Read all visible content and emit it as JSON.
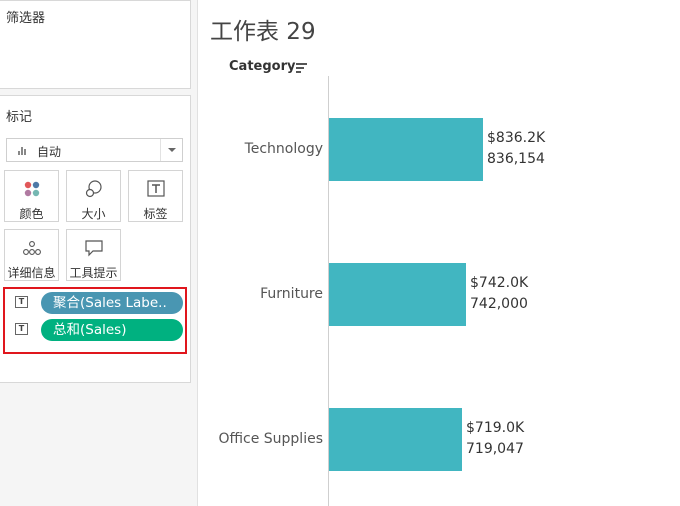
{
  "filters": {
    "title": "筛选器"
  },
  "marks": {
    "title": "标记",
    "mark_type": "自动",
    "buttons": [
      {
        "id": "color",
        "label": "颜色",
        "icon": "color-dots-icon"
      },
      {
        "id": "size",
        "label": "大小",
        "icon": "size-circles-icon"
      },
      {
        "id": "label",
        "label": "标签",
        "icon": "text-label-icon"
      },
      {
        "id": "detail",
        "label": "详细信息",
        "icon": "detail-dots-icon"
      },
      {
        "id": "tooltip",
        "label": "工具提示",
        "icon": "tooltip-bubble-icon"
      }
    ],
    "pills": [
      {
        "text": "聚合(Sales Labe..",
        "color": "#4996b2"
      },
      {
        "text": "总和(Sales)",
        "color": "#00b180"
      }
    ]
  },
  "worksheet": {
    "title": "工作表 29",
    "column_header": "Category"
  },
  "chart_data": {
    "type": "bar",
    "orientation": "horizontal",
    "categories": [
      "Technology",
      "Furniture",
      "Office Supplies"
    ],
    "values": [
      836154,
      742000,
      719047
    ],
    "value_labels": [
      "$836.2K",
      "$742.0K",
      "$719.0K"
    ],
    "count_labels": [
      "836,154",
      "742,000",
      "719,047"
    ],
    "bar_color": "#41b6c1",
    "xlim": [
      0,
      1900000
    ],
    "grid": false
  }
}
